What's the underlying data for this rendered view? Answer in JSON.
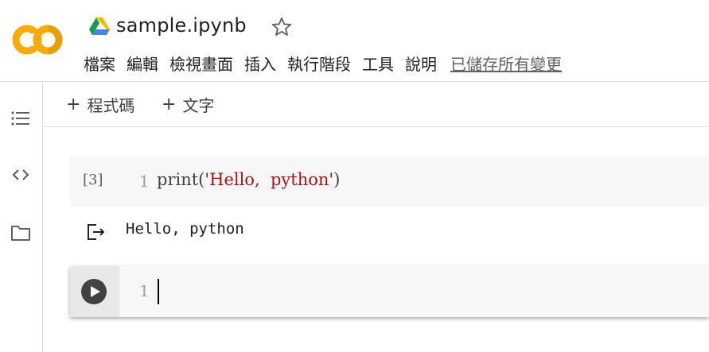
{
  "app": {
    "notebook_title": "sample.ipynb",
    "logo_icon": "colab-logo-icon",
    "brand_colors": {
      "logo_orange": "#f9ab00",
      "logo_yellow": "#e8710a",
      "string": "#a31515"
    }
  },
  "menu": {
    "items": [
      "檔案",
      "編輯",
      "檢視畫面",
      "插入",
      "執行階段",
      "工具",
      "說明"
    ],
    "save_status": "已儲存所有變更"
  },
  "toolbar": {
    "add_code_label": "程式碼",
    "add_text_label": "文字"
  },
  "sidebar": {
    "icons": [
      "table-of-contents-icon",
      "code-snippets-icon",
      "folder-icon"
    ]
  },
  "cells": [
    {
      "execution_count": "[3]",
      "line_number": "1",
      "code_prefix": "print(",
      "code_string": "'Hello,  python'",
      "code_suffix": ")",
      "output": "Hello, python"
    },
    {
      "line_number": "1"
    }
  ]
}
